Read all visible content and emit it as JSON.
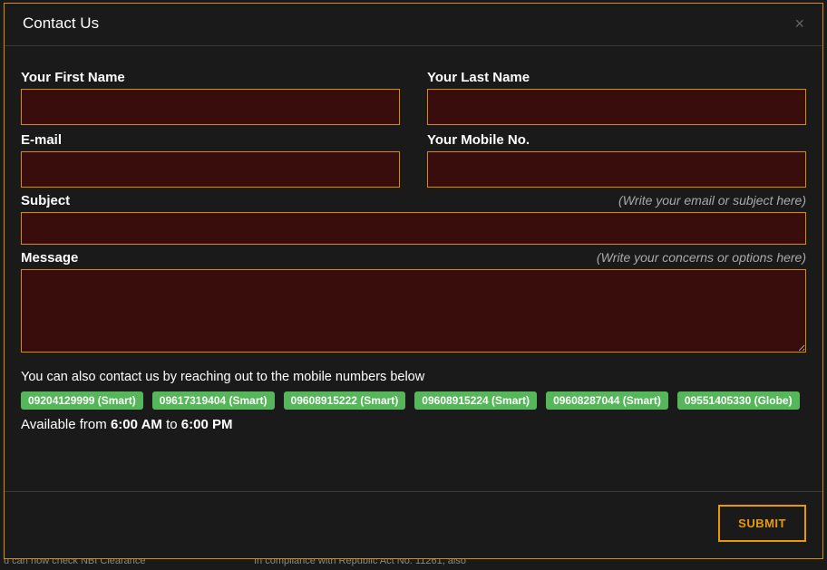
{
  "modal": {
    "title": "Contact Us",
    "close_glyph": "×"
  },
  "fields": {
    "first_name": {
      "label": "Your First Name",
      "value": ""
    },
    "last_name": {
      "label": "Your Last Name",
      "value": ""
    },
    "email": {
      "label": "E-mail",
      "value": ""
    },
    "mobile": {
      "label": "Your Mobile No.",
      "value": ""
    },
    "subject": {
      "label": "Subject",
      "hint": "(Write your email or subject here)",
      "value": ""
    },
    "message": {
      "label": "Message",
      "hint": "(Write your concerns or options here)",
      "value": ""
    }
  },
  "contact_info": {
    "intro": "You can also contact us by reaching out to the mobile numbers below",
    "numbers": [
      "09204129999 (Smart)",
      "09617319404 (Smart)",
      "09608915222 (Smart)",
      "09608915224 (Smart)",
      "09608287044 (Smart)",
      "09551405330 (Globe)"
    ],
    "availability_prefix": "Available from ",
    "availability_start": "6:00 AM",
    "availability_mid": " to ",
    "availability_end": "6:00 PM"
  },
  "footer": {
    "submit_label": "SUBMIT"
  },
  "backdrop": {
    "left_text": "u can now check NBI Clearance",
    "right_text": "In compliance with Republic Act No. 11261, also"
  }
}
